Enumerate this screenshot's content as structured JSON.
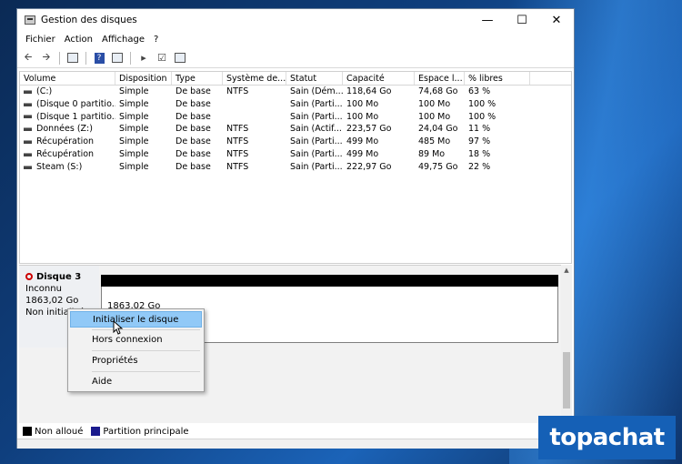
{
  "window": {
    "title": "Gestion des disques"
  },
  "menu": [
    "Fichier",
    "Action",
    "Affichage",
    "?"
  ],
  "columns": [
    "Volume",
    "Disposition",
    "Type",
    "Système de...",
    "Statut",
    "Capacité",
    "Espace l...",
    "% libres"
  ],
  "volumes": [
    [
      "(C:)",
      "Simple",
      "De base",
      "NTFS",
      "Sain (Dém...",
      "118,64 Go",
      "74,68 Go",
      "63 %"
    ],
    [
      "(Disque 0 partitio...",
      "Simple",
      "De base",
      "",
      "Sain (Parti...",
      "100 Mo",
      "100 Mo",
      "100 %"
    ],
    [
      "(Disque 1 partitio...",
      "Simple",
      "De base",
      "",
      "Sain (Parti...",
      "100 Mo",
      "100 Mo",
      "100 %"
    ],
    [
      "Données (Z:)",
      "Simple",
      "De base",
      "NTFS",
      "Sain (Actif...",
      "223,57 Go",
      "24,04 Go",
      "11 %"
    ],
    [
      "Récupération",
      "Simple",
      "De base",
      "NTFS",
      "Sain (Parti...",
      "499 Mo",
      "485 Mo",
      "97 %"
    ],
    [
      "Récupération",
      "Simple",
      "De base",
      "NTFS",
      "Sain (Parti...",
      "499 Mo",
      "89 Mo",
      "18 %"
    ],
    [
      "Steam (S:)",
      "Simple",
      "De base",
      "NTFS",
      "Sain (Parti...",
      "222,97 Go",
      "49,75 Go",
      "22 %"
    ]
  ],
  "disk": {
    "name": "Disque 3",
    "status": "Inconnu",
    "size": "1863,02 Go",
    "init": "Non initialisé",
    "partition_size": "1863,02 Go"
  },
  "context_menu": [
    "Initialiser le disque",
    "Hors connexion",
    "Propriétés",
    "Aide"
  ],
  "legend": [
    {
      "label": "Non alloué",
      "color": "#000000"
    },
    {
      "label": "Partition principale",
      "color": "#1a1a8c"
    }
  ],
  "brand": "topachat",
  "colors": {
    "highlight": "#91c9f7",
    "accent": "#1560b6",
    "error": "#cc0000"
  }
}
